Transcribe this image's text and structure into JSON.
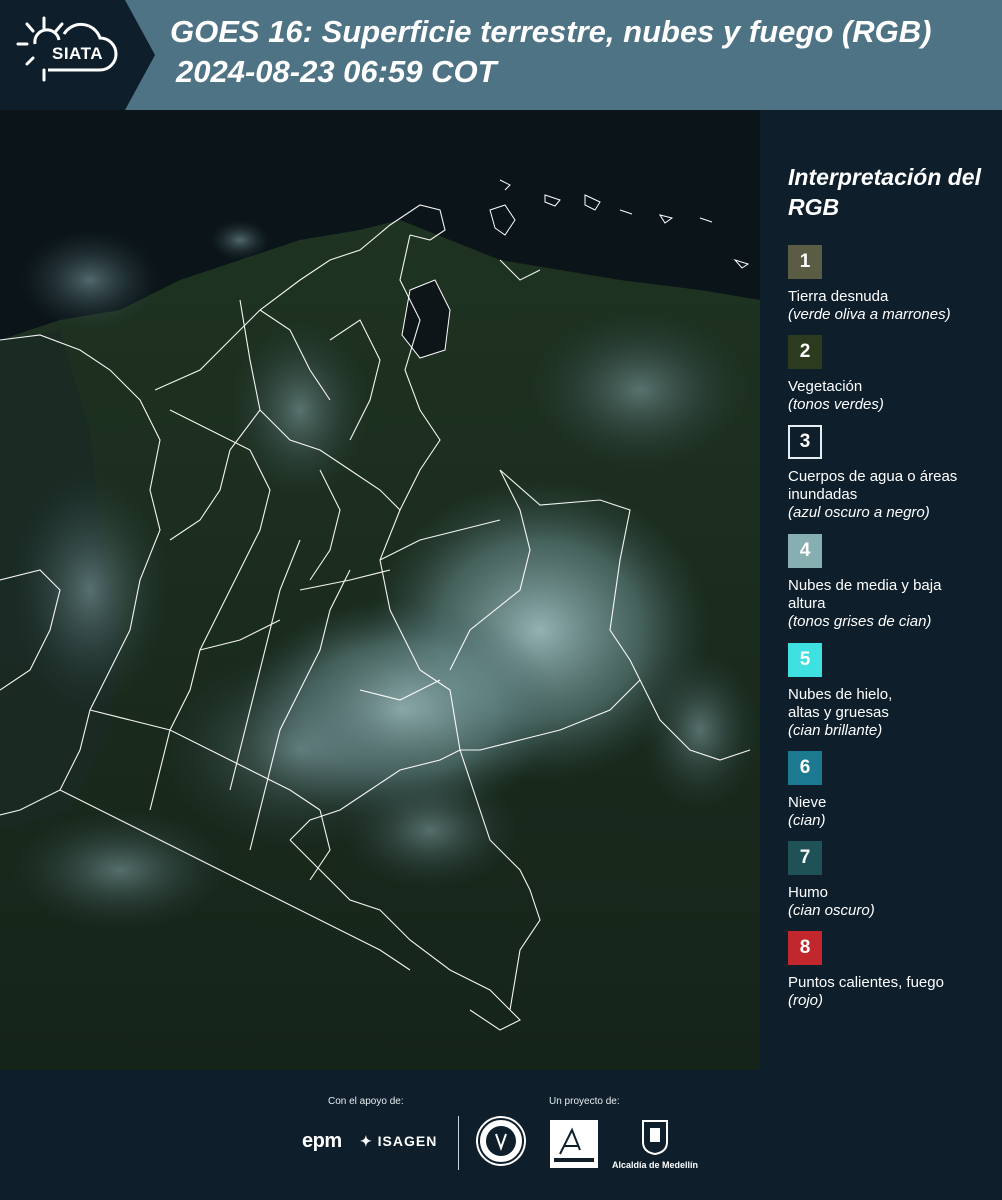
{
  "header": {
    "logo_text": "SIATA",
    "title_line1": "GOES 16: Superficie terrestre, nubes y fuego (RGB)",
    "title_line2": " 2024-08-23 06:59 COT"
  },
  "legend": {
    "title": "Interpretación del RGB",
    "items": [
      {
        "number": "1",
        "color": "#5a5c43",
        "border": "#5a5c43",
        "label": "Tierra desnuda",
        "desc": "(verde oliva a marrones)"
      },
      {
        "number": "2",
        "color": "#2c3b1e",
        "border": "#2c3b1e",
        "label": "Vegetación",
        "desc": "(tonos verdes)"
      },
      {
        "number": "3",
        "color": "#0e1f2b",
        "border": "#e6eef2",
        "label": "Cuerpos de agua o áreas inundadas",
        "desc": "(azul oscuro a negro)"
      },
      {
        "number": "4",
        "color": "#87aeb0",
        "border": "#87aeb0",
        "label": "Nubes de media y baja altura",
        "desc": "(tonos grises de cian)"
      },
      {
        "number": "5",
        "color": "#3fe0e0",
        "border": "#3fe0e0",
        "label": "Nubes de hielo, altas y gruesas",
        "desc": "(cian brillante)"
      },
      {
        "number": "6",
        "color": "#1b7a8f",
        "border": "#1b7a8f",
        "label": "Nieve",
        "desc": "(cian)"
      },
      {
        "number": "7",
        "color": "#1e5257",
        "border": "#1e5257",
        "label": "Humo",
        "desc": "(cian oscuro)"
      },
      {
        "number": "8",
        "color": "#c1272d",
        "border": "#c1272d",
        "label": "Puntos calientes, fuego",
        "desc": "(rojo)"
      }
    ]
  },
  "footer": {
    "support_label": "Con el apoyo de:",
    "project_label": "Un proyecto de:",
    "epm": "epm",
    "isagen": "ISAGEN",
    "alcaldia": "Alcaldía de Medellín"
  },
  "colors": {
    "header_bg": "#4d7384",
    "page_bg": "#0e1f2b",
    "vegetation": "#1c2e1b",
    "cloud": "#7ea5a8",
    "ocean": "#0b1519",
    "border_lines": "#ffffff"
  }
}
